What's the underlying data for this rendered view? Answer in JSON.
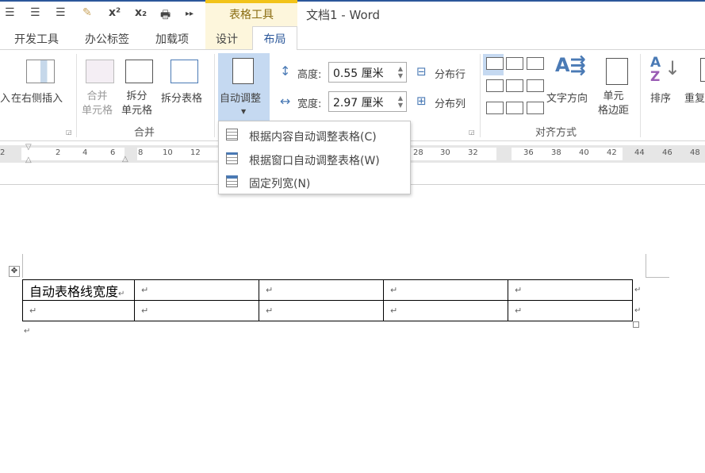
{
  "window": {
    "title": "文档1 - Word",
    "context_group": "表格工具"
  },
  "tabs": [
    "开发工具",
    "办公标签",
    "加载项",
    "设计",
    "布局"
  ],
  "ribbon": {
    "insert_partial": "入",
    "insert_right": "在右侧插入",
    "merge_cells": "合并\n单元格",
    "merge_cells_1": "合并",
    "merge_cells_2": "单元格",
    "split_cells_1": "拆分",
    "split_cells_2": "单元格",
    "split_table": "拆分表格",
    "group_merge": "合并",
    "autofit": "自动调整",
    "height_label": "高度:",
    "height_value": "0.55 厘米",
    "width_label": "宽度:",
    "width_value": "2.97 厘米",
    "distribute_rows": "分布行",
    "distribute_cols": "分布列",
    "text_direction": "文字方向",
    "cell_margins_1": "单元",
    "cell_margins_2": "格边距",
    "group_alignment": "对齐方式",
    "sort": "排序",
    "repeat_partial": "重复"
  },
  "autofit_menu": [
    {
      "label": "根据内容自动调整表格(C)"
    },
    {
      "label": "根据窗口自动调整表格(W)"
    },
    {
      "label": "固定列宽(N)"
    }
  ],
  "ruler_left": [
    "2",
    "2",
    "4",
    "6",
    "8",
    "10",
    "12"
  ],
  "ruler_right": [
    "28",
    "30",
    "32",
    "36",
    "38",
    "40",
    "42",
    "44",
    "46",
    "48"
  ],
  "document": {
    "cell_text": "自动表格线宽度",
    "para_mark": "↵"
  }
}
